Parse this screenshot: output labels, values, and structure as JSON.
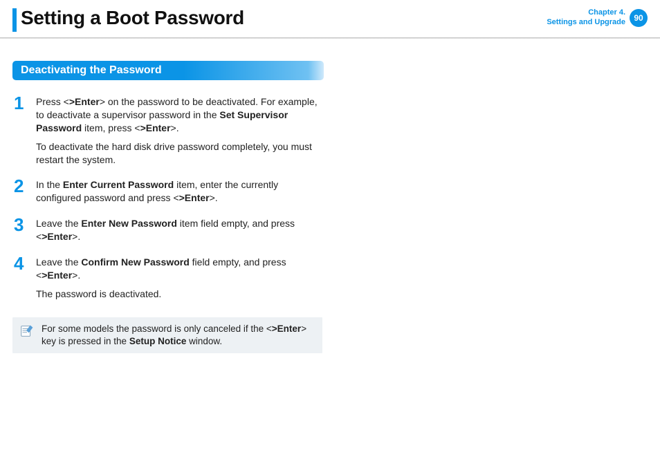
{
  "header": {
    "title": "Setting a Boot Password",
    "chapter_line1": "Chapter 4.",
    "chapter_line2": "Settings and Upgrade",
    "page_number": "90"
  },
  "section": {
    "heading": "Deactivating the Password"
  },
  "steps": [
    {
      "num": "1",
      "paras": [
        "Press <__B__>Enter__END__> on the password to be deactivated. For example, to deactivate a supervisor password in the __B__Set Supervisor Password__END__ item, press <__B__>Enter__END__>.",
        "To deactivate the hard disk drive password completely, you must restart the system."
      ]
    },
    {
      "num": "2",
      "paras": [
        "In the __B__Enter Current Password__END__ item, enter the currently configured password and press <__B__>Enter__END__>."
      ]
    },
    {
      "num": "3",
      "paras": [
        "Leave the __B__Enter New Password__END__ item field empty, and press <__B__>Enter__END__>."
      ]
    },
    {
      "num": "4",
      "paras": [
        "Leave the __B__Confirm New Password__END__ field empty, and press <__B__>Enter__END__>.",
        "The password is deactivated."
      ]
    }
  ],
  "note": {
    "text": "For some models the password is only canceled if the <__B__>Enter__END__> key is pressed in the __B__Setup Notice__END__ window."
  }
}
